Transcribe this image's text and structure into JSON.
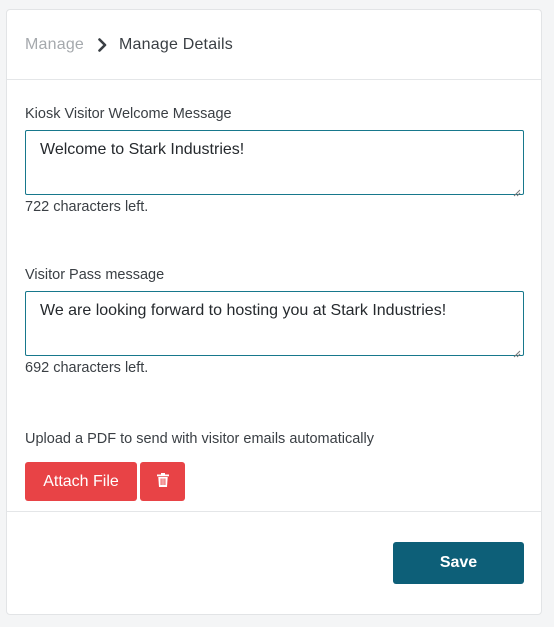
{
  "breadcrumb": {
    "parent": "Manage",
    "current": "Manage Details"
  },
  "welcome": {
    "label": "Kiosk Visitor Welcome Message",
    "value": "Welcome to Stark Industries!",
    "chars_left": "722 characters left."
  },
  "pass": {
    "label": "Visitor Pass message",
    "value": "We are looking forward to hosting you at Stark Industries!",
    "chars_left": "692 characters left."
  },
  "upload": {
    "text": "Upload a PDF to send with visitor emails automatically",
    "attach_label": "Attach File",
    "delete_icon": "trash-icon"
  },
  "footer": {
    "save_label": "Save"
  },
  "colors": {
    "accent_red": "#e84346",
    "save_blue": "#0d5f78",
    "field_border": "#17788c"
  }
}
